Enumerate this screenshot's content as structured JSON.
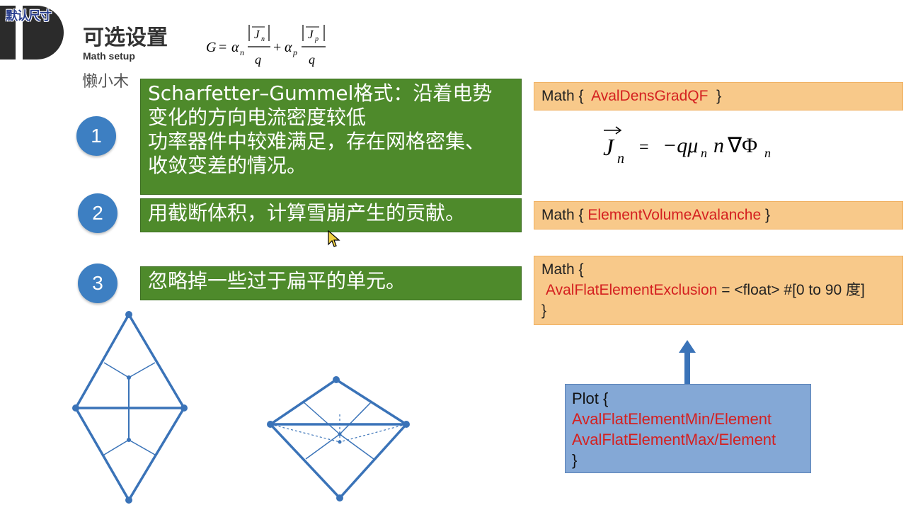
{
  "overlay": {
    "default_size": "默认尺寸"
  },
  "header": {
    "title": "可选设置",
    "subtitle": "Math setup",
    "author": "懒小木"
  },
  "formula_g": {
    "lhs": "G",
    "alpha_n": "α",
    "sub_n": "n",
    "alpha_p": "α",
    "sub_p": "p",
    "jn": "J",
    "jp": "J",
    "q": "q"
  },
  "items": [
    {
      "number": "1",
      "lines": [
        "Scharfetter–Gummel格式：沿着电势",
        "变化的方向电流密度较低",
        "功率器件中较难满足，存在网格密集、",
        "收敛变差的情况。"
      ]
    },
    {
      "number": "2",
      "lines": [
        "用截断体积，计算雪崩产生的贡献。"
      ]
    },
    {
      "number": "3",
      "lines": [
        "忽略掉一些过于扁平的单元。"
      ]
    }
  ],
  "math1": {
    "prefix": "Math {",
    "keyword": "AvalDensGradQF",
    "suffix": "}"
  },
  "formula_jn": {
    "j": "J",
    "n": "n",
    "equals": "=",
    "rhs": "−qμ",
    "rhs_n": "n",
    "nabla_phi": "∇Φ"
  },
  "math2": {
    "prefix": "Math {",
    "keyword": "ElementVolumeAvalanche",
    "suffix": "}"
  },
  "math3": {
    "line1": "Math {",
    "keyword": "AvalFlatElementExclusion",
    "rest": " = <float> #[0 to 90 度]",
    "line3": "}"
  },
  "plot": {
    "line1": "Plot {",
    "item1": "AvalFlatElementMin/Element",
    "item2": "AvalFlatElementMax/Element",
    "line4": "}"
  },
  "colors": {
    "green_box": "#4e8a2b",
    "circle": "#3d7fc2",
    "orange_box": "#f8c98a",
    "blue_box": "#84a8d6",
    "keyword_red": "#d42020",
    "shape_stroke": "#3a73b8"
  }
}
